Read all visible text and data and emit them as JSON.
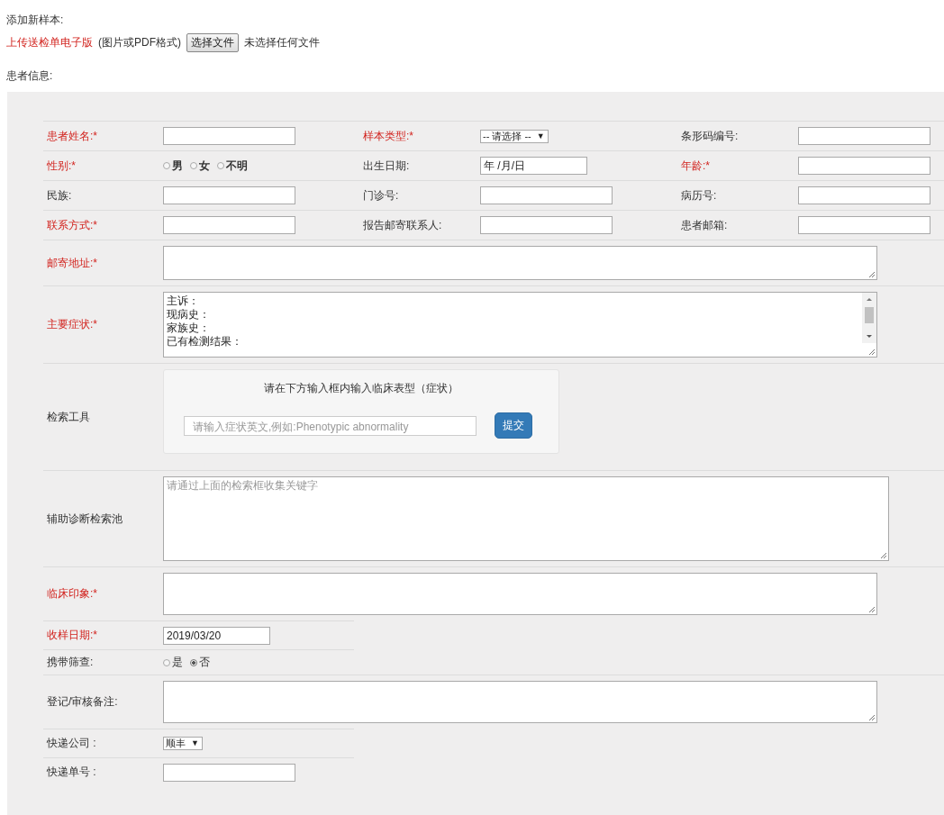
{
  "title": "添加新样本:",
  "upload": {
    "label": "上传送检单电子版",
    "hint": "(图片或PDF格式)",
    "button": "选择文件",
    "status": "未选择任何文件"
  },
  "section_title": "患者信息:",
  "grid_rows": [
    [
      {
        "label": "患者姓名:*",
        "required": true,
        "field": {
          "kind": "text"
        }
      },
      {
        "label": "样本类型:*",
        "required": true,
        "field": {
          "kind": "select",
          "value": "-- 请选择 --",
          "arrow": "▼"
        }
      },
      {
        "label": "条形码编号:",
        "required": false,
        "field": {
          "kind": "text"
        }
      }
    ],
    [
      {
        "label": "性别:*",
        "required": true,
        "field": {
          "kind": "radio",
          "bold": true,
          "options": [
            {
              "label": "男",
              "selected": false
            },
            {
              "label": "女",
              "selected": false
            },
            {
              "label": "不明",
              "selected": false
            }
          ]
        }
      },
      {
        "label": "出生日期:",
        "required": false,
        "field": {
          "kind": "date",
          "value": "年 /月/日"
        }
      },
      {
        "label": "年龄:*",
        "required": true,
        "field": {
          "kind": "text"
        }
      }
    ],
    [
      {
        "label": "民族:",
        "required": false,
        "field": {
          "kind": "text"
        }
      },
      {
        "label": "门诊号:",
        "required": false,
        "field": {
          "kind": "text"
        }
      },
      {
        "label": "病历号:",
        "required": false,
        "field": {
          "kind": "text"
        }
      }
    ],
    [
      {
        "label": "联系方式:*",
        "required": true,
        "field": {
          "kind": "text"
        }
      },
      {
        "label": "报告邮寄联系人:",
        "required": false,
        "field": {
          "kind": "text"
        }
      },
      {
        "label": "患者邮箱:",
        "required": false,
        "field": {
          "kind": "text"
        }
      }
    ]
  ],
  "rows": [
    {
      "label": "邮寄地址:*",
      "required": true,
      "field": {
        "kind": "memo"
      }
    },
    {
      "label": "主要症状:*",
      "required": true,
      "field": {
        "kind": "scrollarea",
        "lines": [
          "主诉：",
          "现病史：",
          "家族史：",
          "已有检测结果："
        ]
      }
    },
    {
      "label": "检索工具",
      "required": false,
      "field": {
        "kind": "searchtool",
        "heading": "请在下方输入框内输入临床表型（症状）",
        "placeholder": "请输入症状英文,例如:Phenotypic abnormality",
        "button": "提交"
      }
    },
    {
      "label": "辅助诊断检索池",
      "required": false,
      "field": {
        "kind": "pool",
        "placeholder": "请通过上面的检索框收集关键字"
      }
    },
    {
      "label": "临床印象:*",
      "required": true,
      "field": {
        "kind": "textarea"
      }
    },
    {
      "label": "收样日期:*",
      "required": true,
      "field": {
        "kind": "text",
        "value": "2019/03/20"
      }
    },
    {
      "label": "携带筛查:",
      "required": false,
      "field": {
        "kind": "radio",
        "bold": false,
        "options": [
          {
            "label": "是",
            "selected": false
          },
          {
            "label": "否",
            "selected": true
          }
        ]
      }
    },
    {
      "label": "登记/审核备注:",
      "required": false,
      "field": {
        "kind": "textarea"
      }
    },
    {
      "label": "快递公司 :",
      "required": false,
      "field": {
        "kind": "select",
        "value": "顺丰",
        "arrow": "▼"
      }
    },
    {
      "label": "快递单号 :",
      "required": false,
      "field": {
        "kind": "text"
      }
    }
  ]
}
